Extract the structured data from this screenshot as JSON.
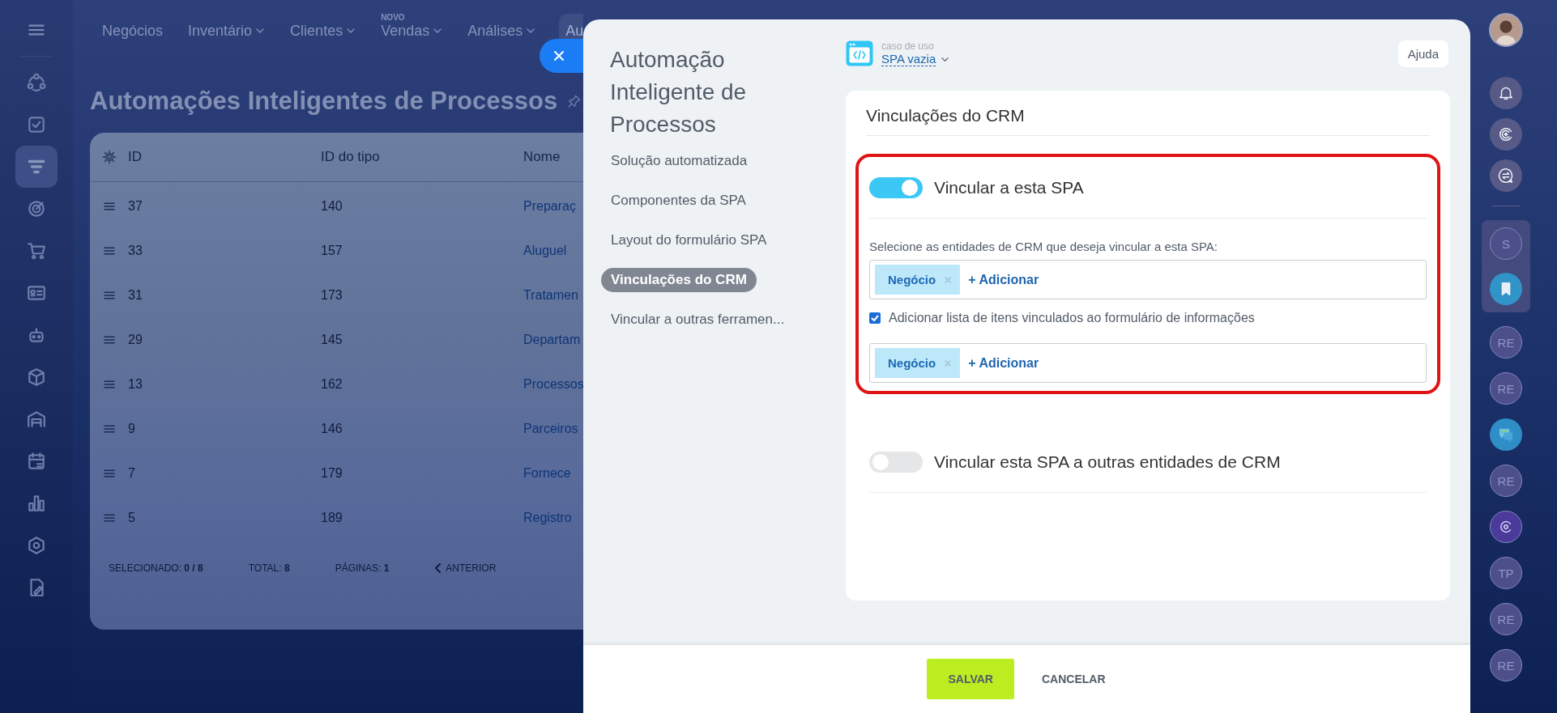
{
  "left_sidebar": {
    "items": [
      {
        "kind": "flow",
        "selected": false
      },
      {
        "kind": "task",
        "selected": false
      },
      {
        "kind": "funnel",
        "selected": true
      },
      {
        "kind": "target",
        "selected": false
      },
      {
        "kind": "cart",
        "selected": false
      },
      {
        "kind": "card",
        "selected": false
      },
      {
        "kind": "robot",
        "selected": false
      },
      {
        "kind": "box",
        "selected": false
      },
      {
        "kind": "warehouse",
        "selected": false
      },
      {
        "kind": "calendar",
        "selected": false
      },
      {
        "kind": "chart",
        "selected": false
      },
      {
        "kind": "hexagon",
        "selected": false
      },
      {
        "kind": "document",
        "selected": false
      }
    ]
  },
  "top_nav": {
    "items": [
      {
        "label": "Negócios",
        "dropdown": false,
        "selected": false
      },
      {
        "label": "Inventário",
        "dropdown": true,
        "selected": false
      },
      {
        "label": "Clientes",
        "dropdown": true,
        "selected": false
      },
      {
        "label": "Vendas",
        "dropdown": true,
        "badge": "NOVO",
        "selected": false
      },
      {
        "label": "Análises",
        "dropdown": true,
        "selected": false
      },
      {
        "label": "Au",
        "dropdown": false,
        "selected": true
      }
    ]
  },
  "page": {
    "title": "Automações Inteligentes de Processos"
  },
  "table": {
    "columns": [
      "ID",
      "ID do tipo",
      "Nome"
    ],
    "rows": [
      [
        "37",
        "140",
        "Preparaç"
      ],
      [
        "33",
        "157",
        "Aluguel"
      ],
      [
        "31",
        "173",
        "Tratamen"
      ],
      [
        "29",
        "145",
        "Departam"
      ],
      [
        "13",
        "162",
        "Processos"
      ],
      [
        "9",
        "146",
        "Parceiros"
      ],
      [
        "7",
        "179",
        "Fornece"
      ],
      [
        "5",
        "189",
        "Registro"
      ]
    ],
    "footer": {
      "selected_label": "SELECIONADO:",
      "selected_value": "0 / 8",
      "total_label": "TOTAL:",
      "total_value": "8",
      "pages_label": "PÁGINAS:",
      "pages_value": "1",
      "previous": "ANTERIOR"
    }
  },
  "slider": {
    "title": "Automação Inteligente de Processos",
    "nav": [
      {
        "label": "Solução automatizada",
        "selected": false
      },
      {
        "label": "Componentes da SPA",
        "selected": false
      },
      {
        "label": "Layout do formulário SPA",
        "selected": false
      },
      {
        "label": "Vinculações do CRM",
        "selected": true
      },
      {
        "label": "Vincular a outras ferramen...",
        "selected": false
      }
    ],
    "use_case": {
      "label": "caso de uso",
      "value": "SPA vazia"
    },
    "help": "Ajuda",
    "card": {
      "title": "Vinculações do CRM",
      "sections": [
        {
          "label": "Vincular a esta SPA",
          "on": true,
          "highlighted": true,
          "prompt": "Selecione as entidades de CRM que deseja vincular a esta SPA:",
          "entities": {
            "tags": [
              "Negócio"
            ],
            "add": "+ Adicionar"
          },
          "checkbox": {
            "label": "Adicionar lista de itens vinculados ao formulário de informações",
            "checked": true
          },
          "linked_entities": {
            "tags": [
              "Negócio"
            ],
            "add": "+ Adicionar"
          }
        },
        {
          "label": "Vincular esta SPA a outras entidades de CRM",
          "on": false,
          "highlighted": false
        }
      ]
    },
    "buttons": [
      {
        "label": "SALVAR",
        "kind": "primary"
      },
      {
        "label": "CANCELAR",
        "kind": "link"
      }
    ]
  },
  "right_rail": {
    "top": [
      {
        "kind": "avatar"
      },
      {
        "kind": "bell"
      },
      {
        "kind": "sparkle"
      },
      {
        "kind": "swap-chat"
      }
    ],
    "pinned": [
      {
        "kind": "initials",
        "text": "S"
      },
      {
        "kind": "bookmark"
      }
    ],
    "apps": [
      {
        "kind": "initials",
        "text": "RE"
      },
      {
        "kind": "initials",
        "text": "RE"
      },
      {
        "kind": "chat"
      },
      {
        "kind": "initials",
        "text": "RE"
      },
      {
        "kind": "copilot"
      },
      {
        "kind": "initials",
        "text": "TP"
      },
      {
        "kind": "initials",
        "text": "RE"
      },
      {
        "kind": "initials",
        "text": "RE"
      }
    ]
  }
}
